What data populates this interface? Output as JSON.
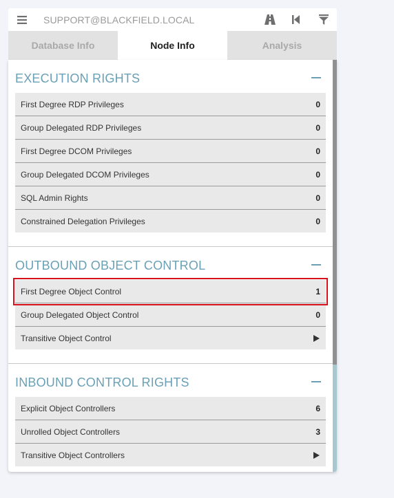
{
  "search": {
    "value": "SUPPORT@BLACKFIELD.LOCAL",
    "menu_icon": "hamburger-icon",
    "tools": [
      "pathfinding-icon",
      "back-icon",
      "filter-icon"
    ]
  },
  "tabs": [
    {
      "label": "Database Info",
      "active": false
    },
    {
      "label": "Node Info",
      "active": true
    },
    {
      "label": "Analysis",
      "active": false
    }
  ],
  "colors": {
    "section_title": "#6aa0b5",
    "highlight": "#d8101a",
    "row_bg": "#e9e9e9"
  },
  "sections": [
    {
      "title": "EXECUTION RIGHTS",
      "rows": [
        {
          "label": "First Degree RDP Privileges",
          "value": "0"
        },
        {
          "label": "Group Delegated RDP Privileges",
          "value": "0"
        },
        {
          "label": "First Degree DCOM Privileges",
          "value": "0"
        },
        {
          "label": "Group Delegated DCOM Privileges",
          "value": "0"
        },
        {
          "label": "SQL Admin Rights",
          "value": "0"
        },
        {
          "label": "Constrained Delegation Privileges",
          "value": "0"
        }
      ]
    },
    {
      "title": "OUTBOUND OBJECT CONTROL",
      "rows": [
        {
          "label": "First Degree Object Control",
          "value": "1"
        },
        {
          "label": "Group Delegated Object Control",
          "value": "0"
        },
        {
          "label": "Transitive Object Control",
          "value": "play-icon"
        }
      ]
    },
    {
      "title": "INBOUND CONTROL RIGHTS",
      "rows": [
        {
          "label": "Explicit Object Controllers",
          "value": "6"
        },
        {
          "label": "Unrolled Object Controllers",
          "value": "3"
        },
        {
          "label": "Transitive Object Controllers",
          "value": "play-icon"
        }
      ]
    }
  ]
}
